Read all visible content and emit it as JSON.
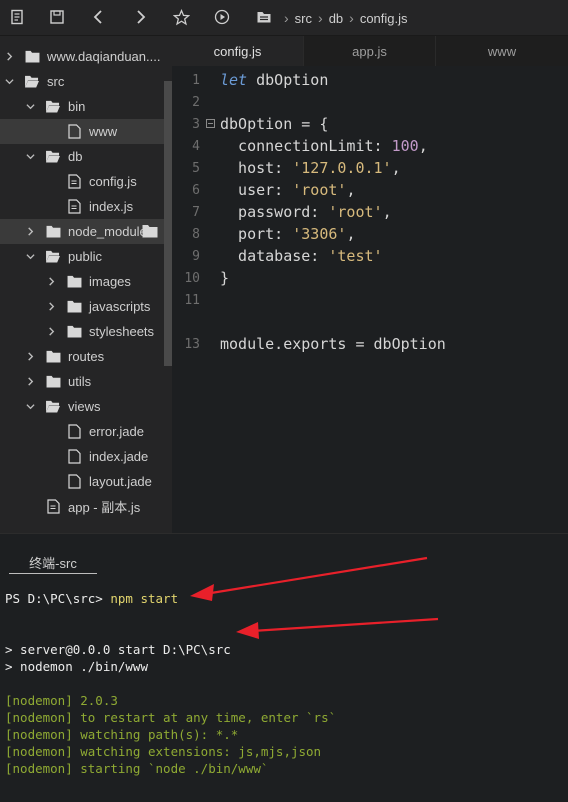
{
  "toolbar": {
    "icons": [
      "file-icon",
      "save-icon",
      "back-icon",
      "forward-icon",
      "star-icon",
      "play-icon"
    ],
    "breadcrumb": [
      "src",
      "db",
      "config.js"
    ]
  },
  "sidebar": {
    "items": [
      {
        "label": "www.daqianduan....",
        "type": "folder",
        "expanded": false,
        "depth": 0
      },
      {
        "label": "src",
        "type": "folder",
        "expanded": true,
        "depth": 0
      },
      {
        "label": "bin",
        "type": "folder",
        "expanded": true,
        "depth": 1
      },
      {
        "label": "www",
        "type": "file",
        "depth": 2,
        "selected": true
      },
      {
        "label": "db",
        "type": "folder",
        "expanded": true,
        "depth": 1
      },
      {
        "label": "config.js",
        "type": "js-file",
        "depth": 2
      },
      {
        "label": "index.js",
        "type": "js-file",
        "depth": 2
      },
      {
        "label": "node_modules",
        "type": "folder",
        "expanded": false,
        "depth": 1,
        "hovered": true
      },
      {
        "label": "public",
        "type": "folder",
        "expanded": true,
        "depth": 1
      },
      {
        "label": "images",
        "type": "folder",
        "expanded": false,
        "depth": 2
      },
      {
        "label": "javascripts",
        "type": "folder",
        "expanded": false,
        "depth": 2
      },
      {
        "label": "stylesheets",
        "type": "folder",
        "expanded": false,
        "depth": 2
      },
      {
        "label": "routes",
        "type": "folder",
        "expanded": false,
        "depth": 1
      },
      {
        "label": "utils",
        "type": "folder",
        "expanded": false,
        "depth": 1
      },
      {
        "label": "views",
        "type": "folder",
        "expanded": true,
        "depth": 1
      },
      {
        "label": "error.jade",
        "type": "file",
        "depth": 2
      },
      {
        "label": "index.jade",
        "type": "file",
        "depth": 2
      },
      {
        "label": "layout.jade",
        "type": "file",
        "depth": 2
      },
      {
        "label": "app - 副本.js",
        "type": "js-file",
        "depth": 1
      }
    ]
  },
  "tabs": [
    {
      "label": "config.js",
      "active": true
    },
    {
      "label": "app.js",
      "active": false
    },
    {
      "label": "www",
      "active": false
    }
  ],
  "editor": {
    "lines": [
      {
        "n": "1",
        "tokens": [
          [
            "kw",
            "let"
          ],
          [
            "code",
            " dbOption"
          ]
        ]
      },
      {
        "n": "2",
        "tokens": []
      },
      {
        "n": "3",
        "fold": "⊟",
        "tokens": [
          [
            "code",
            "dbOption = {"
          ]
        ]
      },
      {
        "n": "4",
        "tokens": [
          [
            "code",
            "  connectionLimit: "
          ],
          [
            "num",
            "100"
          ],
          [
            "code",
            ","
          ]
        ]
      },
      {
        "n": "5",
        "tokens": [
          [
            "code",
            "  host: "
          ],
          [
            "str",
            "'127.0.0.1'"
          ],
          [
            "code",
            ","
          ]
        ]
      },
      {
        "n": "6",
        "tokens": [
          [
            "code",
            "  user: "
          ],
          [
            "str",
            "'root'"
          ],
          [
            "code",
            ","
          ]
        ]
      },
      {
        "n": "7",
        "tokens": [
          [
            "code",
            "  password: "
          ],
          [
            "str",
            "'root'"
          ],
          [
            "code",
            ","
          ]
        ]
      },
      {
        "n": "8",
        "tokens": [
          [
            "code",
            "  port: "
          ],
          [
            "str",
            "'3306'"
          ],
          [
            "code",
            ","
          ]
        ]
      },
      {
        "n": "9",
        "tokens": [
          [
            "code",
            "  database: "
          ],
          [
            "str",
            "'test'"
          ]
        ]
      },
      {
        "n": "10",
        "tokens": [
          [
            "code",
            "}"
          ]
        ]
      },
      {
        "n": "11",
        "tokens": []
      },
      {
        "n": "",
        "tokens": []
      },
      {
        "n": "13",
        "tokens": [
          [
            "code",
            "module.exports = dbOption"
          ]
        ]
      }
    ]
  },
  "terminal": {
    "tab_label": "终端-src",
    "lines": [
      {
        "text": "PS D:\\PC\\src> ",
        "cls": "t-white",
        "extra": "npm start",
        "extra_cls": "t-yellow"
      },
      {
        "text": "",
        "cls": "t-white"
      },
      {
        "text": "> server@0.0.0 start D:\\PC\\src",
        "cls": "t-white"
      },
      {
        "text": "> nodemon ./bin/www",
        "cls": "t-white"
      },
      {
        "text": "",
        "cls": "t-white"
      },
      {
        "text": "[nodemon] 2.0.3",
        "cls": "t-green"
      },
      {
        "text": "[nodemon] to restart at any time, enter `rs`",
        "cls": "t-green"
      },
      {
        "text": "[nodemon] watching path(s): *.*",
        "cls": "t-green"
      },
      {
        "text": "[nodemon] watching extensions: js,mjs,json",
        "cls": "t-green"
      },
      {
        "text": "[nodemon] starting `node ./bin/www`",
        "cls": "t-green"
      }
    ]
  },
  "colors": {
    "background": "#1d1f21",
    "sidebar": "#252526",
    "keyword": "#6b9bd6",
    "number": "#c39ac9",
    "string": "#d7ba7d",
    "nodemon_green": "#8faa33",
    "command_yellow": "#e2d56e",
    "annotation_arrow": "#e8202a"
  }
}
